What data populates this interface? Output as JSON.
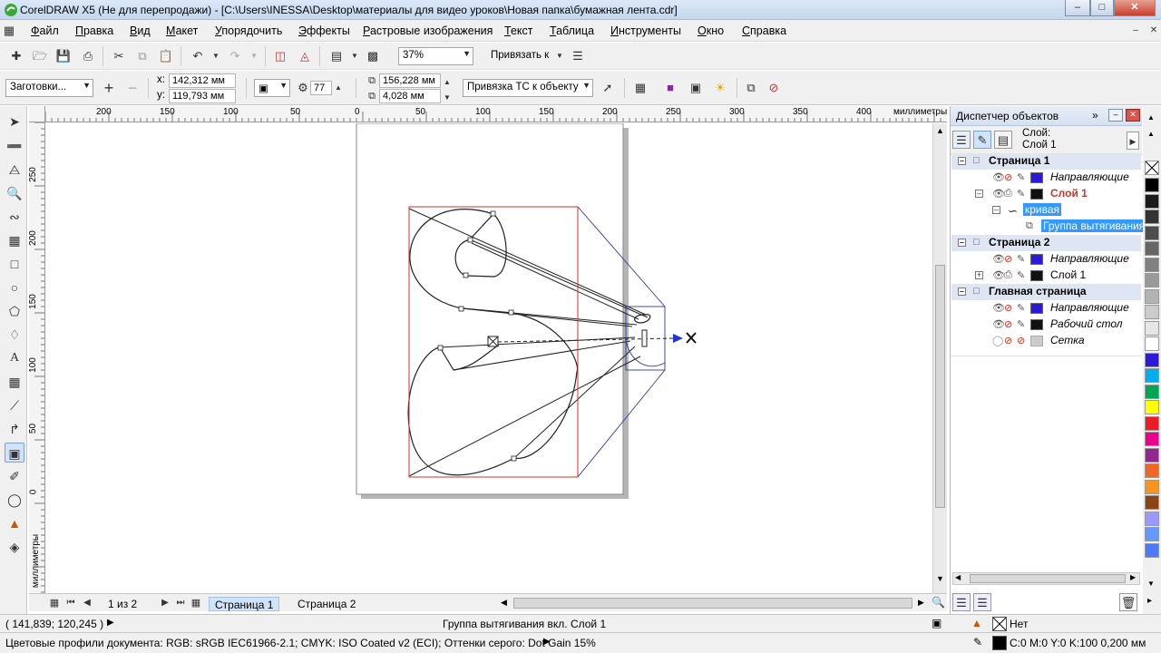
{
  "window": {
    "title": "CorelDRAW X5 (Не для перепродажи) - [C:\\Users\\INESSA\\Desktop\\материалы для видео уроков\\Новая папка\\бумажная лента.cdr]"
  },
  "menu": {
    "items": [
      {
        "first": "Ф",
        "rest": "айл"
      },
      {
        "first": "П",
        "rest": "равка"
      },
      {
        "first": "В",
        "rest": "ид"
      },
      {
        "first": "М",
        "rest": "акет"
      },
      {
        "first": "У",
        "rest": "порядочить"
      },
      {
        "first": "Э",
        "rest": "ффекты"
      },
      {
        "first": "Р",
        "rest": "астровые изображения"
      },
      {
        "first": "Т",
        "rest": "екст"
      },
      {
        "first": "Т",
        "rest": "аблица"
      },
      {
        "first": "И",
        "rest": "нструменты"
      },
      {
        "first": "О",
        "rest": "кно"
      },
      {
        "first": "С",
        "rest": "правка"
      }
    ]
  },
  "toolbar": {
    "zoom": "37%",
    "snap_label": "Привязать к"
  },
  "propbar": {
    "presets": "Заготовки...",
    "x_label": "x:",
    "x_value": "142,312 мм",
    "y_label": "y:",
    "y_value": "119,793 мм",
    "steps": "77",
    "width_value": "156,228 мм",
    "height_value": "4,028 мм",
    "vp_mode": "Привязка ТС к объекту"
  },
  "ruler": {
    "h_ticks": [
      "200",
      "150",
      "100",
      "50",
      "0",
      "50",
      "100",
      "150",
      "200",
      "250",
      "300",
      "350",
      "400"
    ],
    "h_unit": "миллиметры",
    "v_ticks": [
      "250",
      "200",
      "150",
      "100",
      "50",
      "0"
    ],
    "v_unit": "миллиметры"
  },
  "pages": {
    "counter": "1 из 2",
    "tabs": [
      "Страница 1",
      "Страница 2"
    ]
  },
  "docker": {
    "title": "Диспетчер объектов",
    "layer_label": "Слой:",
    "layer_name": "Слой 1",
    "tree": {
      "page1": "Страница 1",
      "guides1": "Направляющие",
      "layer1": "Слой 1",
      "curve": "кривая",
      "extrude_group": "Группа вытягивания",
      "page2": "Страница 2",
      "guides2": "Направляющие",
      "layer1_p2": "Слой 1",
      "master": "Главная страница",
      "guides_master": "Направляющие",
      "desktop": "Рабочий стол",
      "grid": "Сетка"
    }
  },
  "palette": {
    "colors": [
      "#000000",
      "#1a1a1a",
      "#333333",
      "#4d4d4d",
      "#666666",
      "#808080",
      "#999999",
      "#b3b3b3",
      "#cccccc",
      "#e6e6e6",
      "#ffffff",
      "#2b1bd9",
      "#00aeef",
      "#00a651",
      "#ffff00",
      "#ed1c24",
      "#ec008c",
      "#92278f",
      "#f26522",
      "#f7941d",
      "#8b4513",
      "#9999ff",
      "#6699ff",
      "#4d79ff"
    ]
  },
  "status": {
    "coords": "( 141,839; 120,245 )",
    "info": "Группа вытягивания вкл. Слой 1",
    "fill": "Нет",
    "profile": "Цветовые профили документа: RGB: sRGB IEC61966-2.1; CMYK: ISO Coated v2 (ECI); Оттенки серого: Dot Gain 15%",
    "outline": "C:0 M:0 Y:0 K:100  0,200 мм"
  }
}
